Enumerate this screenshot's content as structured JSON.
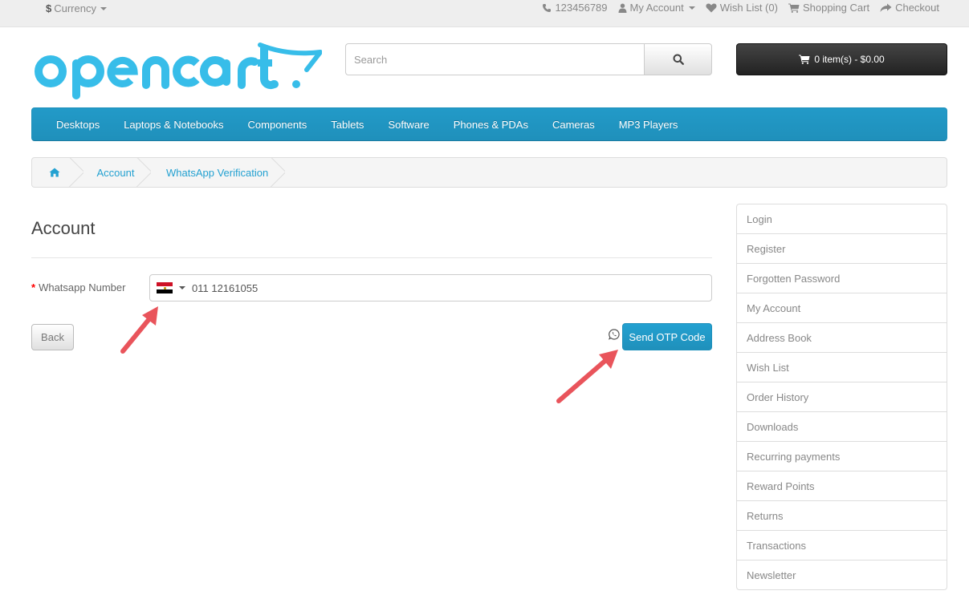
{
  "topbar": {
    "currency": "Currency",
    "currency_symbol": "$",
    "phone": "123456789",
    "my_account": "My Account",
    "wish_list": "Wish List (0)",
    "shopping_cart": "Shopping Cart",
    "checkout": "Checkout"
  },
  "header": {
    "logo_text": "opencart",
    "search_placeholder": "Search",
    "cart": "0 item(s) - $0.00"
  },
  "menu": {
    "items": [
      "Desktops",
      "Laptops & Notebooks",
      "Components",
      "Tablets",
      "Software",
      "Phones & PDAs",
      "Cameras",
      "MP3 Players"
    ]
  },
  "breadcrumb": {
    "items": [
      "Account",
      "WhatsApp Verification"
    ]
  },
  "main": {
    "title": "Account",
    "field_required": "*",
    "field_label": "Whatsapp Number",
    "phone_value": "011 12161055",
    "back_label": "Back",
    "send_label": "Send OTP Code"
  },
  "sidebar": {
    "items": [
      "Login",
      "Register",
      "Forgotten Password",
      "My Account",
      "Address Book",
      "Wish List",
      "Order History",
      "Downloads",
      "Recurring payments",
      "Reward Points",
      "Returns",
      "Transactions",
      "Newsletter"
    ]
  },
  "colors": {
    "accent": "#229ac8",
    "logo": "#37bde9",
    "arrow": "#e9545b"
  },
  "icons": [
    "phone-icon",
    "user-icon",
    "heart-icon",
    "cart-icon",
    "share-icon",
    "search-icon",
    "home-icon",
    "whatsapp-icon",
    "egypt-flag-icon"
  ]
}
